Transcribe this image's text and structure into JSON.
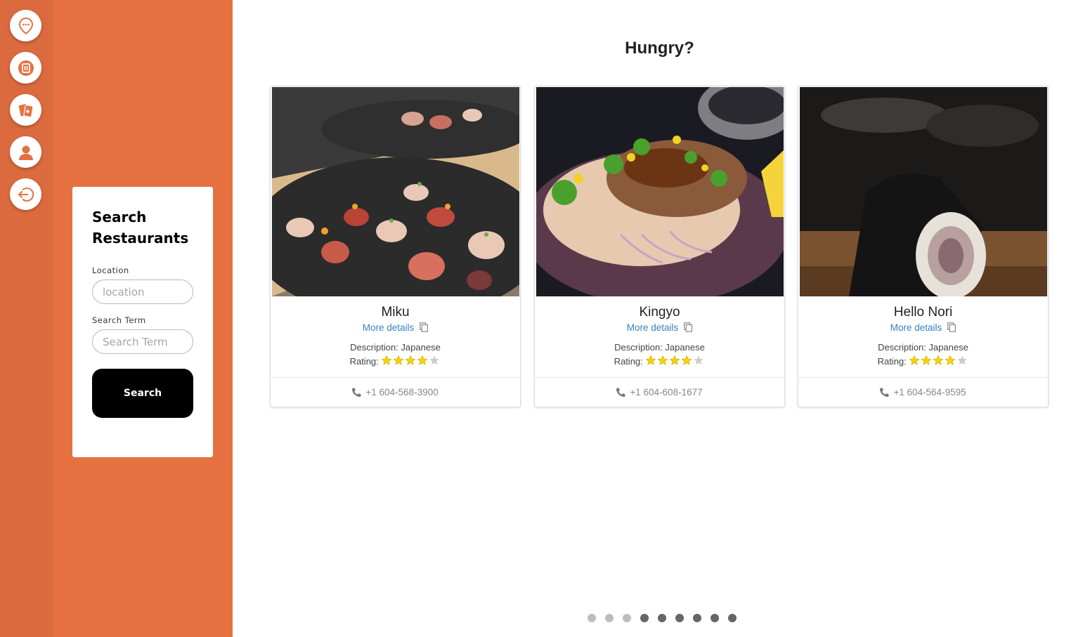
{
  "page": {
    "heading": "Hungry?"
  },
  "rail": {
    "items": [
      {
        "name": "chat-location-icon"
      },
      {
        "name": "restaurant-icon"
      },
      {
        "name": "cards-icon"
      },
      {
        "name": "profile-icon"
      },
      {
        "name": "logout-icon"
      }
    ],
    "accent": "#e57141"
  },
  "search": {
    "title": "Search Restaurants",
    "location_label": "Location",
    "location_placeholder": "location",
    "term_label": "Search Term",
    "term_placeholder": "Search Term",
    "button_label": "Search"
  },
  "restaurants": [
    {
      "name": "Miku",
      "more_label": "More details",
      "description": "Description: Japanese",
      "rating_label": "Rating:",
      "rating": 4,
      "rating_max": 5,
      "phone": "+1 604-568-3900"
    },
    {
      "name": "Kingyo",
      "more_label": "More details",
      "description": "Description: Japanese",
      "rating_label": "Rating:",
      "rating": 4,
      "rating_max": 5,
      "phone": "+1 604-608-1677"
    },
    {
      "name": "Hello Nori",
      "more_label": "More details",
      "description": "Description: Japanese",
      "rating_label": "Rating:",
      "rating": 4,
      "rating_max": 5,
      "phone": "+1 604-564-9595"
    }
  ],
  "carousel": {
    "total": 9,
    "light_count": 3,
    "light_color": "#bdbdbd",
    "dark_color": "#666666"
  },
  "colors": {
    "link": "#3a7fc0",
    "star": "#f5d20f",
    "star_empty": "#cccccc"
  }
}
